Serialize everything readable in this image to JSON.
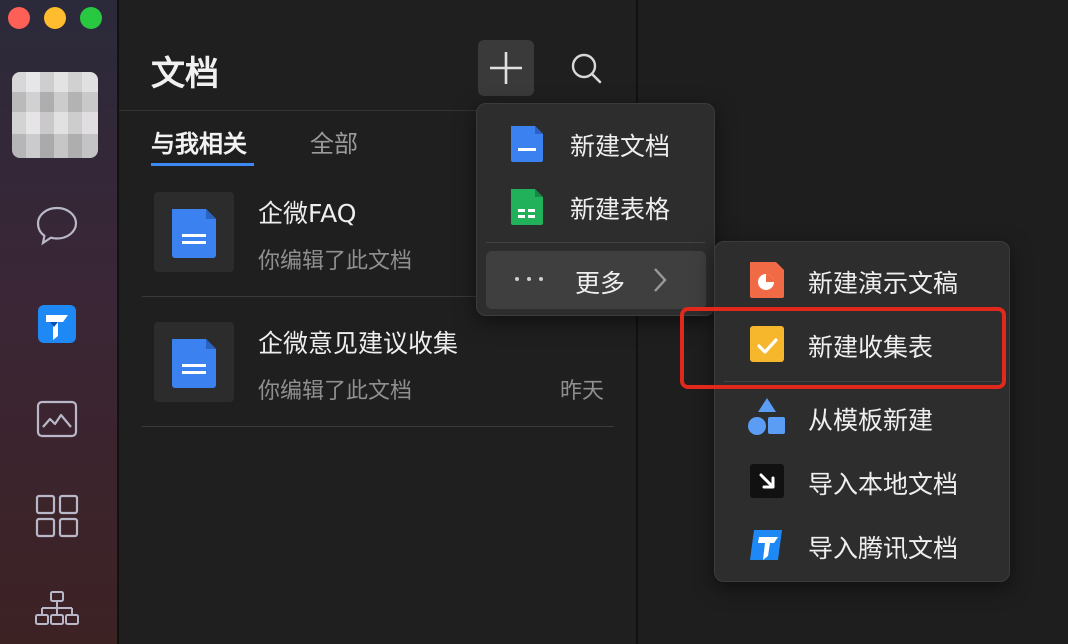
{
  "sidebar": {
    "icons": [
      "chat-icon",
      "tencent-docs-icon",
      "drive-icon",
      "apps-grid-icon",
      "org-chart-icon"
    ],
    "traffic_colors": [
      "#fe5f57",
      "#febc2e",
      "#28c840"
    ]
  },
  "panel": {
    "title": "文档",
    "tabs": [
      {
        "label": "与我相关",
        "active": true
      },
      {
        "label": "全部",
        "active": false
      }
    ],
    "docs": [
      {
        "name": "企微FAQ",
        "subtitle": "你编辑了此文档",
        "time": ""
      },
      {
        "name": "企微意见建议收集",
        "subtitle": "你编辑了此文档",
        "time": "昨天"
      }
    ]
  },
  "new_menu": {
    "items": [
      {
        "label": "新建文档",
        "icon": "doc-icon"
      },
      {
        "label": "新建表格",
        "icon": "sheet-icon"
      }
    ],
    "more_label": "更多"
  },
  "more_menu": {
    "items": [
      {
        "label": "新建演示文稿",
        "icon": "slides-icon"
      },
      {
        "label": "新建收集表",
        "icon": "form-icon"
      },
      {
        "label": "从模板新建",
        "icon": "template-icon"
      },
      {
        "label": "导入本地文档",
        "icon": "import-local-icon"
      },
      {
        "label": "导入腾讯文档",
        "icon": "import-tencent-icon"
      }
    ]
  },
  "colors": {
    "accent": "#3d8af7",
    "highlight": "#e0291c",
    "doc_blue": "#3b82f0",
    "sheet_green": "#20b15a",
    "slides_orange": "#f06a45",
    "form_yellow": "#f7b72d"
  }
}
